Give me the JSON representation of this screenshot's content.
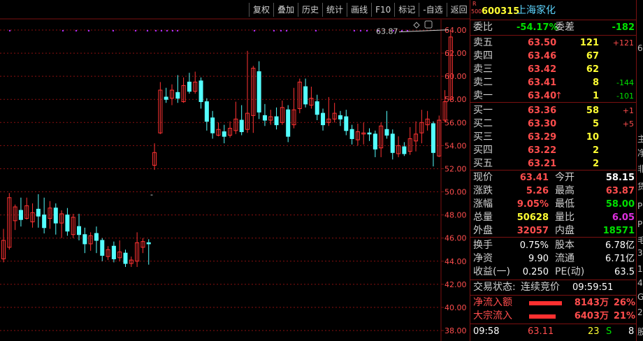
{
  "colors": {
    "up": "#ff3232",
    "down": "#54ffff",
    "axis": "#7a1010",
    "grid": "#8b1010",
    "dot": "#b030ff",
    "price": "#ff4d4d",
    "green": "#00e000",
    "yellow": "#ffff33",
    "magenta": "#e030e0"
  },
  "toolbar": [
    "复权",
    "叠加",
    "历史",
    "统计",
    "画线",
    "F10",
    "标记",
    "-自选",
    "返回"
  ],
  "chart_data": {
    "type": "candlestick",
    "y_ticks": [
      "64.00",
      "62.00",
      "60.00",
      "58.00",
      "56.00",
      "54.00",
      "52.00",
      "50.00",
      "48.00",
      "46.00",
      "44.00",
      "42.00",
      "40.00",
      "38.00"
    ],
    "ylim": [
      37.8,
      64.4
    ],
    "annotation": "63.87",
    "gap_mark": "-",
    "candles": [
      [
        44.2,
        45.8,
        43.9,
        46.8
      ],
      [
        45.2,
        49.5,
        45.0,
        49.9
      ],
      [
        47.5,
        48.7,
        46.7,
        48.9
      ],
      [
        48.4,
        47.6,
        47.0,
        49.5
      ],
      [
        47.7,
        48.8,
        47.6,
        49.5
      ],
      [
        47.4,
        48.2,
        46.9,
        49.0
      ],
      [
        48.5,
        47.9,
        46.9,
        49.8
      ],
      [
        48.0,
        46.9,
        46.4,
        49.5
      ],
      [
        47.7,
        48.6,
        46.8,
        49.2
      ],
      [
        48.6,
        47.3,
        46.3,
        49.0
      ],
      [
        47.3,
        48.1,
        46.0,
        48.4
      ],
      [
        48.0,
        46.6,
        46.2,
        48.6
      ],
      [
        46.3,
        47.8,
        46.0,
        48.1
      ],
      [
        47.0,
        46.3,
        45.8,
        48.1
      ],
      [
        46.3,
        45.5,
        44.7,
        46.9
      ],
      [
        45.5,
        46.2,
        44.9,
        46.5
      ],
      [
        46.4,
        45.8,
        44.7,
        47.0
      ],
      [
        45.8,
        44.5,
        44.0,
        46.0
      ],
      [
        44.4,
        45.0,
        44.1,
        45.3
      ],
      [
        45.3,
        44.2,
        43.9,
        45.7
      ],
      [
        44.3,
        44.8,
        44.0,
        45.8
      ],
      [
        44.7,
        43.8,
        43.5,
        45.0
      ],
      [
        43.8,
        44.1,
        43.5,
        44.4
      ],
      [
        44.0,
        45.6,
        43.5,
        46.5
      ],
      [
        45.2,
        45.7,
        44.7,
        46.0
      ],
      [
        45.6,
        45.5,
        43.7,
        45.9
      ],
      [
        52.3,
        53.4,
        51.9,
        54.2
      ],
      [
        55.1,
        58.8,
        55.0,
        59.5
      ],
      [
        58.2,
        58.0,
        57.7,
        59.0
      ],
      [
        58.1,
        58.8,
        57.5,
        59.3
      ],
      [
        58.6,
        58.1,
        57.7,
        60.1
      ],
      [
        57.8,
        59.2,
        57.7,
        59.9
      ],
      [
        59.5,
        58.7,
        58.5,
        60.3
      ],
      [
        58.7,
        59.5,
        58.5,
        60.4
      ],
      [
        59.6,
        57.8,
        57.2,
        59.9
      ],
      [
        57.8,
        56.1,
        55.3,
        58.1
      ],
      [
        56.4,
        55.1,
        54.6,
        57.0
      ],
      [
        54.9,
        55.4,
        54.8,
        56.0
      ],
      [
        55.2,
        54.8,
        54.2,
        55.8
      ],
      [
        54.9,
        55.5,
        54.7,
        56.1
      ],
      [
        55.3,
        56.3,
        55.0,
        57.8
      ],
      [
        56.2,
        55.2,
        54.9,
        57.5
      ],
      [
        55.4,
        56.8,
        55.1,
        62.2
      ],
      [
        56.6,
        60.7,
        55.1,
        60.9
      ],
      [
        60.4,
        56.9,
        56.3,
        61.3
      ],
      [
        56.6,
        56.2,
        55.7,
        57.6
      ],
      [
        56.2,
        56.5,
        55.8,
        57.1
      ],
      [
        56.5,
        55.8,
        55.4,
        57.3
      ],
      [
        56.0,
        57.3,
        55.8,
        57.9
      ],
      [
        57.1,
        54.8,
        54.3,
        57.5
      ],
      [
        55.8,
        57.1,
        55.5,
        59.0
      ],
      [
        57.2,
        59.5,
        56.8,
        59.8
      ],
      [
        59.1,
        57.6,
        57.3,
        59.8
      ],
      [
        57.5,
        58.1,
        57.2,
        59.1
      ],
      [
        57.8,
        56.7,
        56.2,
        58.4
      ],
      [
        56.8,
        55.8,
        55.3,
        57.2
      ],
      [
        56.0,
        56.3,
        55.7,
        58.2
      ],
      [
        56.3,
        56.8,
        56.0,
        57.7
      ],
      [
        56.6,
        56.3,
        55.7,
        57.0
      ],
      [
        56.5,
        55.3,
        54.9,
        57.1
      ],
      [
        55.4,
        54.6,
        54.1,
        55.8
      ],
      [
        54.5,
        55.2,
        54.0,
        55.9
      ],
      [
        55.0,
        55.1,
        54.1,
        56.0
      ],
      [
        55.1,
        55.0,
        54.4,
        55.5
      ],
      [
        55.0,
        53.7,
        53.0,
        55.3
      ],
      [
        53.8,
        55.7,
        53.0,
        56.0
      ],
      [
        55.4,
        54.9,
        54.6,
        57.0
      ],
      [
        55.0,
        53.4,
        52.8,
        55.4
      ],
      [
        53.3,
        54.0,
        53.0,
        54.8
      ],
      [
        53.9,
        53.3,
        53.1,
        54.3
      ],
      [
        53.5,
        54.6,
        53.2,
        55.6
      ],
      [
        54.4,
        55.0,
        53.5,
        56.1
      ],
      [
        55.1,
        56.0,
        54.2,
        57.1
      ],
      [
        55.8,
        56.3,
        55.3,
        57.0
      ],
      [
        55.9,
        53.4,
        52.2,
        56.1
      ],
      [
        53.1,
        56.2,
        53.0,
        56.6
      ],
      [
        56.2,
        57.8,
        56.0,
        58.8
      ],
      [
        58.0,
        63.4,
        57.9,
        63.9
      ]
    ],
    "dot_positions": [
      14,
      90,
      109,
      127,
      162,
      194,
      211,
      223,
      231,
      239,
      247,
      254,
      364,
      392,
      402,
      410,
      452,
      507,
      516,
      525,
      541,
      563,
      575,
      583
    ]
  },
  "quote": {
    "code": "600315",
    "name": "上海家化",
    "r_tag": "R",
    "num_tag": "500",
    "weibi_label": "委比",
    "weibi": "-54.17%",
    "weicha_label": "委差",
    "weicha": "-182",
    "sells": [
      {
        "label": "卖五",
        "price": "63.50",
        "vol": "121",
        "chg": "+121"
      },
      {
        "label": "卖四",
        "price": "63.46",
        "vol": "67",
        "chg": ""
      },
      {
        "label": "卖三",
        "price": "63.42",
        "vol": "62",
        "chg": ""
      },
      {
        "label": "卖二",
        "price": "63.41",
        "vol": "8",
        "chg": "-144"
      },
      {
        "label": "卖一",
        "price": "63.40",
        "vol": "1",
        "chg": "-101",
        "arrow": "↑"
      }
    ],
    "buys": [
      {
        "label": "买一",
        "price": "63.36",
        "vol": "58",
        "chg": "+1"
      },
      {
        "label": "买二",
        "price": "63.30",
        "vol": "5",
        "chg": "+5"
      },
      {
        "label": "买三",
        "price": "63.29",
        "vol": "10",
        "chg": ""
      },
      {
        "label": "买四",
        "price": "63.22",
        "vol": "2",
        "chg": ""
      },
      {
        "label": "买五",
        "price": "63.21",
        "vol": "2",
        "chg": ""
      }
    ],
    "stats": [
      {
        "l1": "现价",
        "v1": "63.41",
        "c1": "red",
        "l2": "今开",
        "v2": "58.15",
        "c2": "white"
      },
      {
        "l1": "涨跌",
        "v1": "5.26",
        "c1": "red",
        "l2": "最高",
        "v2": "63.87",
        "c2": "red"
      },
      {
        "l1": "涨幅",
        "v1": "9.05%",
        "c1": "red",
        "l2": "最低",
        "v2": "58.00",
        "c2": "green"
      },
      {
        "l1": "总量",
        "v1": "50628",
        "c1": "yellow",
        "l2": "量比",
        "v2": "6.05",
        "c2": "magenta"
      },
      {
        "l1": "外盘",
        "v1": "32057",
        "c1": "red",
        "l2": "内盘",
        "v2": "18571",
        "c2": "green"
      }
    ],
    "stats2": [
      {
        "l1": "换手",
        "v1": "0.75%",
        "l2": "股本",
        "v2": "6.78亿"
      },
      {
        "l1": "净资",
        "v1": "9.90",
        "l2": "流通",
        "v2": "6.71亿"
      },
      {
        "l1": "收益(一)",
        "v1": "0.250",
        "l2": "PE(动)",
        "v2": "63.5"
      }
    ],
    "status_label": "交易状态:",
    "status_value": "连续竞价",
    "status_time": "09:59:51",
    "flows": [
      {
        "label": "净流入额",
        "amount": "8143万",
        "pct": "26%",
        "bar": 0.26
      },
      {
        "label": "大宗流入",
        "amount": "6403万",
        "pct": "21%",
        "bar": 0.21
      }
    ],
    "tick": {
      "time": "09:58",
      "price": "63.11",
      "vol": "23",
      "side": "S",
      "n": "8"
    }
  },
  "right_strip": [
    "6",
    "主",
    "净",
    "非",
    "货",
    "P",
    "P",
    "毛",
    "3",
    "1",
    "4",
    "G",
    "2",
    "股"
  ]
}
